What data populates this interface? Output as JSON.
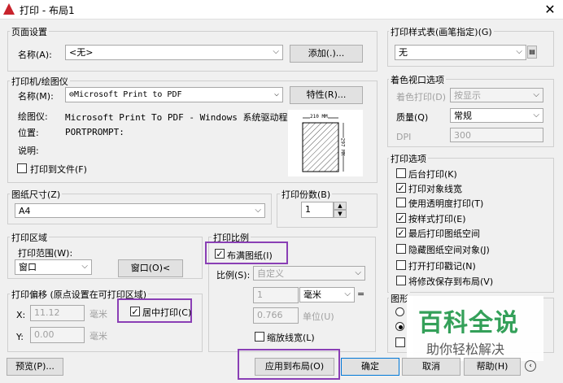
{
  "title": "打印 - 布局1",
  "page_setup": {
    "group": "页面设置",
    "name_label": "名称(A):",
    "name_value": "<无>",
    "add_button": "添加(.)..."
  },
  "printer": {
    "group": "打印机/绘图仪",
    "name_label": "名称(M):",
    "name_value": "Microsoft Print to PDF",
    "props_button": "特性(R)...",
    "plotter_label": "绘图仪:",
    "plotter_value": "Microsoft Print To PDF - Windows 系统驱动程...",
    "location_label": "位置:",
    "location_value": "PORTPROMPT:",
    "desc_label": "说明:",
    "print_to_file": "打印到文件(F)",
    "preview_width": "210 MM",
    "preview_height": "297 MM"
  },
  "paper": {
    "group": "图纸尺寸(Z)",
    "value": "A4"
  },
  "copies": {
    "group": "打印份数(B)",
    "value": "1"
  },
  "area": {
    "group": "打印区域",
    "range_label": "打印范围(W):",
    "range_value": "窗口",
    "window_button": "窗口(O)<"
  },
  "offset": {
    "group": "打印偏移 (原点设置在可打印区域)",
    "x_label": "X:",
    "x_value": "11.12",
    "x_unit": "毫米",
    "y_label": "Y:",
    "y_value": "0.00",
    "y_unit": "毫米",
    "center": "居中打印(C)"
  },
  "scale": {
    "group": "打印比例",
    "fit": "布满图纸(I)",
    "scale_label": "比例(S):",
    "scale_value": "自定义",
    "val1": "1",
    "unit": "毫米",
    "eq": "=",
    "val2": "0.766",
    "unit2": "单位(U)",
    "lineweights": "缩放线宽(L)"
  },
  "style_table": {
    "group": "打印样式表(画笔指定)(G)",
    "value": "无"
  },
  "shaded": {
    "group": "着色视口选项",
    "shade_label": "着色打印(D)",
    "shade_value": "按显示",
    "quality_label": "质量(Q)",
    "quality_value": "常规",
    "dpi_label": "DPI",
    "dpi_value": "300"
  },
  "options": {
    "group": "打印选项",
    "items": [
      {
        "label": "后台打印(K)",
        "checked": false
      },
      {
        "label": "打印对象线宽",
        "checked": true
      },
      {
        "label": "使用透明度打印(T)",
        "checked": false
      },
      {
        "label": "按样式打印(E)",
        "checked": true
      },
      {
        "label": "最后打印图纸空间",
        "checked": true
      },
      {
        "label": "隐藏图纸空间对象(J)",
        "checked": false
      },
      {
        "label": "打开打印戳记(N)",
        "checked": false
      },
      {
        "label": "将修改保存到布局(V)",
        "checked": false
      }
    ]
  },
  "orientation": {
    "group": "图形"
  },
  "buttons": {
    "preview": "预览(P)...",
    "apply": "应用到布局(O)",
    "ok": "确定",
    "cancel": "取消",
    "help": "帮助(H)"
  },
  "watermark": {
    "title": "百科全说",
    "subtitle": "助你轻松解决"
  },
  "colors": {
    "highlight": "#8a3fb5",
    "watermark_green": "#2e9e55"
  }
}
